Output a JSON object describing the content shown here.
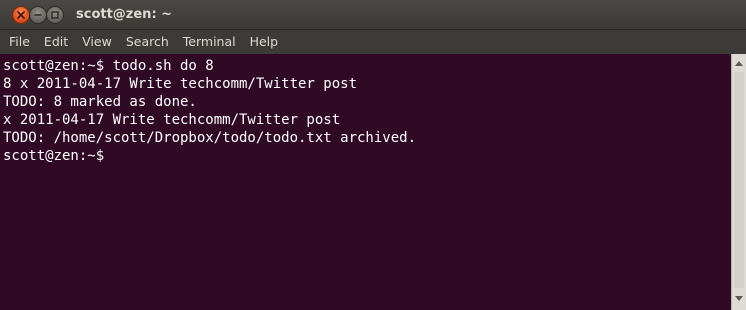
{
  "window": {
    "title": "scott@zen: ~",
    "controls": [
      "close-icon",
      "minimize-icon",
      "maximize-icon"
    ]
  },
  "menubar": {
    "items": [
      {
        "label": "File"
      },
      {
        "label": "Edit"
      },
      {
        "label": "View"
      },
      {
        "label": "Search"
      },
      {
        "label": "Terminal"
      },
      {
        "label": "Help"
      }
    ]
  },
  "terminal": {
    "lines": [
      "scott@zen:~$ todo.sh do 8",
      "8 x 2011-04-17 Write techcomm/Twitter post",
      "TODO: 8 marked as done.",
      "x 2011-04-17 Write techcomm/Twitter post",
      "TODO: /home/scott/Dropbox/todo/todo.txt archived.",
      "scott@zen:~$ "
    ]
  },
  "colors": {
    "terminal_background": "#300a24",
    "terminal_foreground": "#ffffff",
    "titlebar": "#3c3b37",
    "close_button": "#e0501c"
  }
}
